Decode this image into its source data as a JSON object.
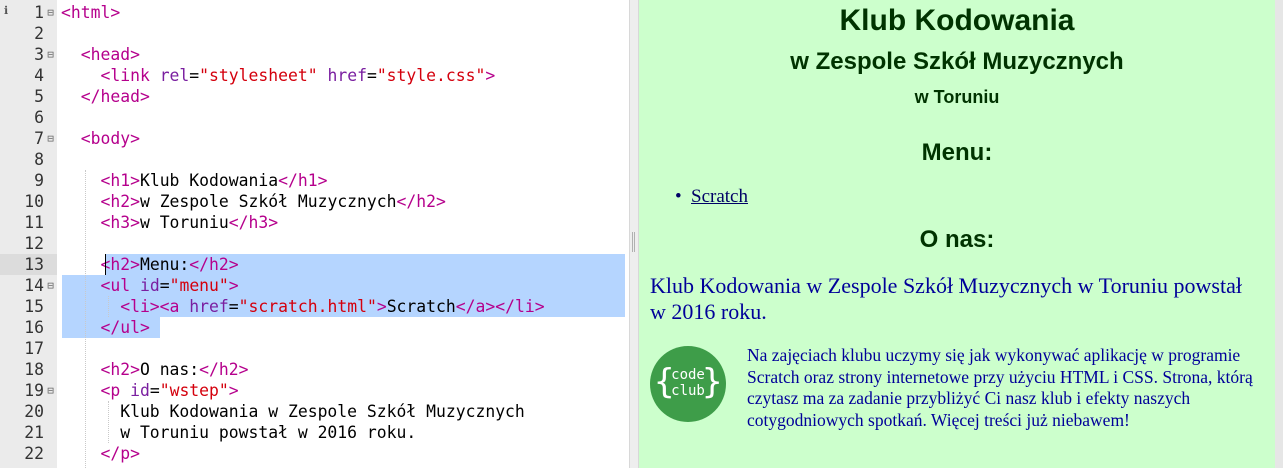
{
  "editor": {
    "marker": "ℹ",
    "lines": [
      {
        "num": "1",
        "fold": "⊟",
        "parts": [
          {
            "t": "<html>",
            "c": "tg"
          }
        ]
      },
      {
        "num": "2",
        "fold": "",
        "parts": []
      },
      {
        "num": "3",
        "fold": "⊟",
        "parts": [
          {
            "t": "  <head>",
            "c": "tg"
          }
        ]
      },
      {
        "num": "4",
        "fold": "",
        "parts": [
          {
            "t": "    <link ",
            "c": "tg"
          },
          {
            "t": "rel",
            "c": "at"
          },
          {
            "t": "=",
            "c": "tx"
          },
          {
            "t": "\"stylesheet\"",
            "c": "st"
          },
          {
            "t": " href",
            "c": "at"
          },
          {
            "t": "=",
            "c": "tx"
          },
          {
            "t": "\"style.css\"",
            "c": "st"
          },
          {
            "t": ">",
            "c": "tg"
          }
        ]
      },
      {
        "num": "5",
        "fold": "",
        "parts": [
          {
            "t": "  </head>",
            "c": "tg"
          }
        ]
      },
      {
        "num": "6",
        "fold": "",
        "parts": []
      },
      {
        "num": "7",
        "fold": "⊟",
        "parts": [
          {
            "t": "  <body>",
            "c": "tg"
          }
        ]
      },
      {
        "num": "8",
        "fold": "",
        "parts": []
      },
      {
        "num": "9",
        "fold": "",
        "parts": [
          {
            "t": "    <h1>",
            "c": "tg"
          },
          {
            "t": "Klub Kodowania",
            "c": "tx"
          },
          {
            "t": "</h1>",
            "c": "tg"
          }
        ]
      },
      {
        "num": "10",
        "fold": "",
        "parts": [
          {
            "t": "    <h2>",
            "c": "tg"
          },
          {
            "t": "w Zespole Szkół Muzycznych",
            "c": "tx"
          },
          {
            "t": "</h2>",
            "c": "tg"
          }
        ]
      },
      {
        "num": "11",
        "fold": "",
        "parts": [
          {
            "t": "    <h3>",
            "c": "tg"
          },
          {
            "t": "w Toruniu",
            "c": "tx"
          },
          {
            "t": "</h3>",
            "c": "tg"
          }
        ]
      },
      {
        "num": "12",
        "fold": "",
        "parts": []
      },
      {
        "num": "13",
        "fold": "",
        "parts": [
          {
            "t": "    <h2>",
            "c": "tg"
          },
          {
            "t": "Menu:",
            "c": "tx"
          },
          {
            "t": "</h2>",
            "c": "tg"
          }
        ]
      },
      {
        "num": "14",
        "fold": "⊟",
        "parts": [
          {
            "t": "    <ul ",
            "c": "tg"
          },
          {
            "t": "id",
            "c": "at"
          },
          {
            "t": "=",
            "c": "tx"
          },
          {
            "t": "\"menu\"",
            "c": "st"
          },
          {
            "t": ">",
            "c": "tg"
          }
        ]
      },
      {
        "num": "15",
        "fold": "",
        "parts": [
          {
            "t": "      <li><a ",
            "c": "tg"
          },
          {
            "t": "href",
            "c": "at"
          },
          {
            "t": "=",
            "c": "tx"
          },
          {
            "t": "\"scratch.html\"",
            "c": "st"
          },
          {
            "t": ">",
            "c": "tg"
          },
          {
            "t": "Scratch",
            "c": "tx"
          },
          {
            "t": "</a></li>",
            "c": "tg"
          }
        ]
      },
      {
        "num": "16",
        "fold": "",
        "parts": [
          {
            "t": "    </ul>",
            "c": "tg"
          }
        ]
      },
      {
        "num": "17",
        "fold": "",
        "parts": []
      },
      {
        "num": "18",
        "fold": "",
        "parts": [
          {
            "t": "    <h2>",
            "c": "tg"
          },
          {
            "t": "O nas:",
            "c": "tx"
          },
          {
            "t": "</h2>",
            "c": "tg"
          }
        ]
      },
      {
        "num": "19",
        "fold": "⊟",
        "parts": [
          {
            "t": "    <p ",
            "c": "tg"
          },
          {
            "t": "id",
            "c": "at"
          },
          {
            "t": "=",
            "c": "tx"
          },
          {
            "t": "\"wstep\"",
            "c": "st"
          },
          {
            "t": ">",
            "c": "tg"
          }
        ]
      },
      {
        "num": "20",
        "fold": "",
        "parts": [
          {
            "t": "      Klub Kodowania w Zespole Szkół Muzycznych",
            "c": "tx"
          }
        ]
      },
      {
        "num": "21",
        "fold": "",
        "parts": [
          {
            "t": "      w Toruniu powstał w 2016 roku.",
            "c": "tx"
          }
        ]
      },
      {
        "num": "22",
        "fold": "",
        "parts": [
          {
            "t": "    </p>",
            "c": "tg"
          }
        ]
      }
    ]
  },
  "preview": {
    "title": "Klub Kodowania",
    "subtitle": "w Zespole Szkół Muzycznych",
    "city": "w Toruniu",
    "menu_heading": "Menu:",
    "menu_items": [
      {
        "label": "Scratch"
      }
    ],
    "about_heading": "O nas:",
    "intro": "Klub Kodowania w Zespole Szkół Muzycznych w Toruniu powstał w 2016 roku.",
    "logo": {
      "word1": "code",
      "word2": "club",
      "brace_left": "{",
      "brace_right": "}"
    },
    "paragraph": "Na zajęciach klubu uczymy się jak wykonywać aplikację w programie Scratch oraz strony internetowe przy użyciu HTML i CSS. Strona, którą czytasz ma za zadanie przybliżyć Ci nasz klub i efekty naszych cotygodniowych spotkań. Więcej treści już niebawem!"
  },
  "colors": {
    "tag": "#b5008c",
    "attribute": "#7a1fa0",
    "string": "#d4000d",
    "selection": "#b5d5ff",
    "preview_background": "#ccffcc",
    "preview_heading": "#003300",
    "preview_text": "#000099",
    "logo_green": "#3e9d49"
  }
}
